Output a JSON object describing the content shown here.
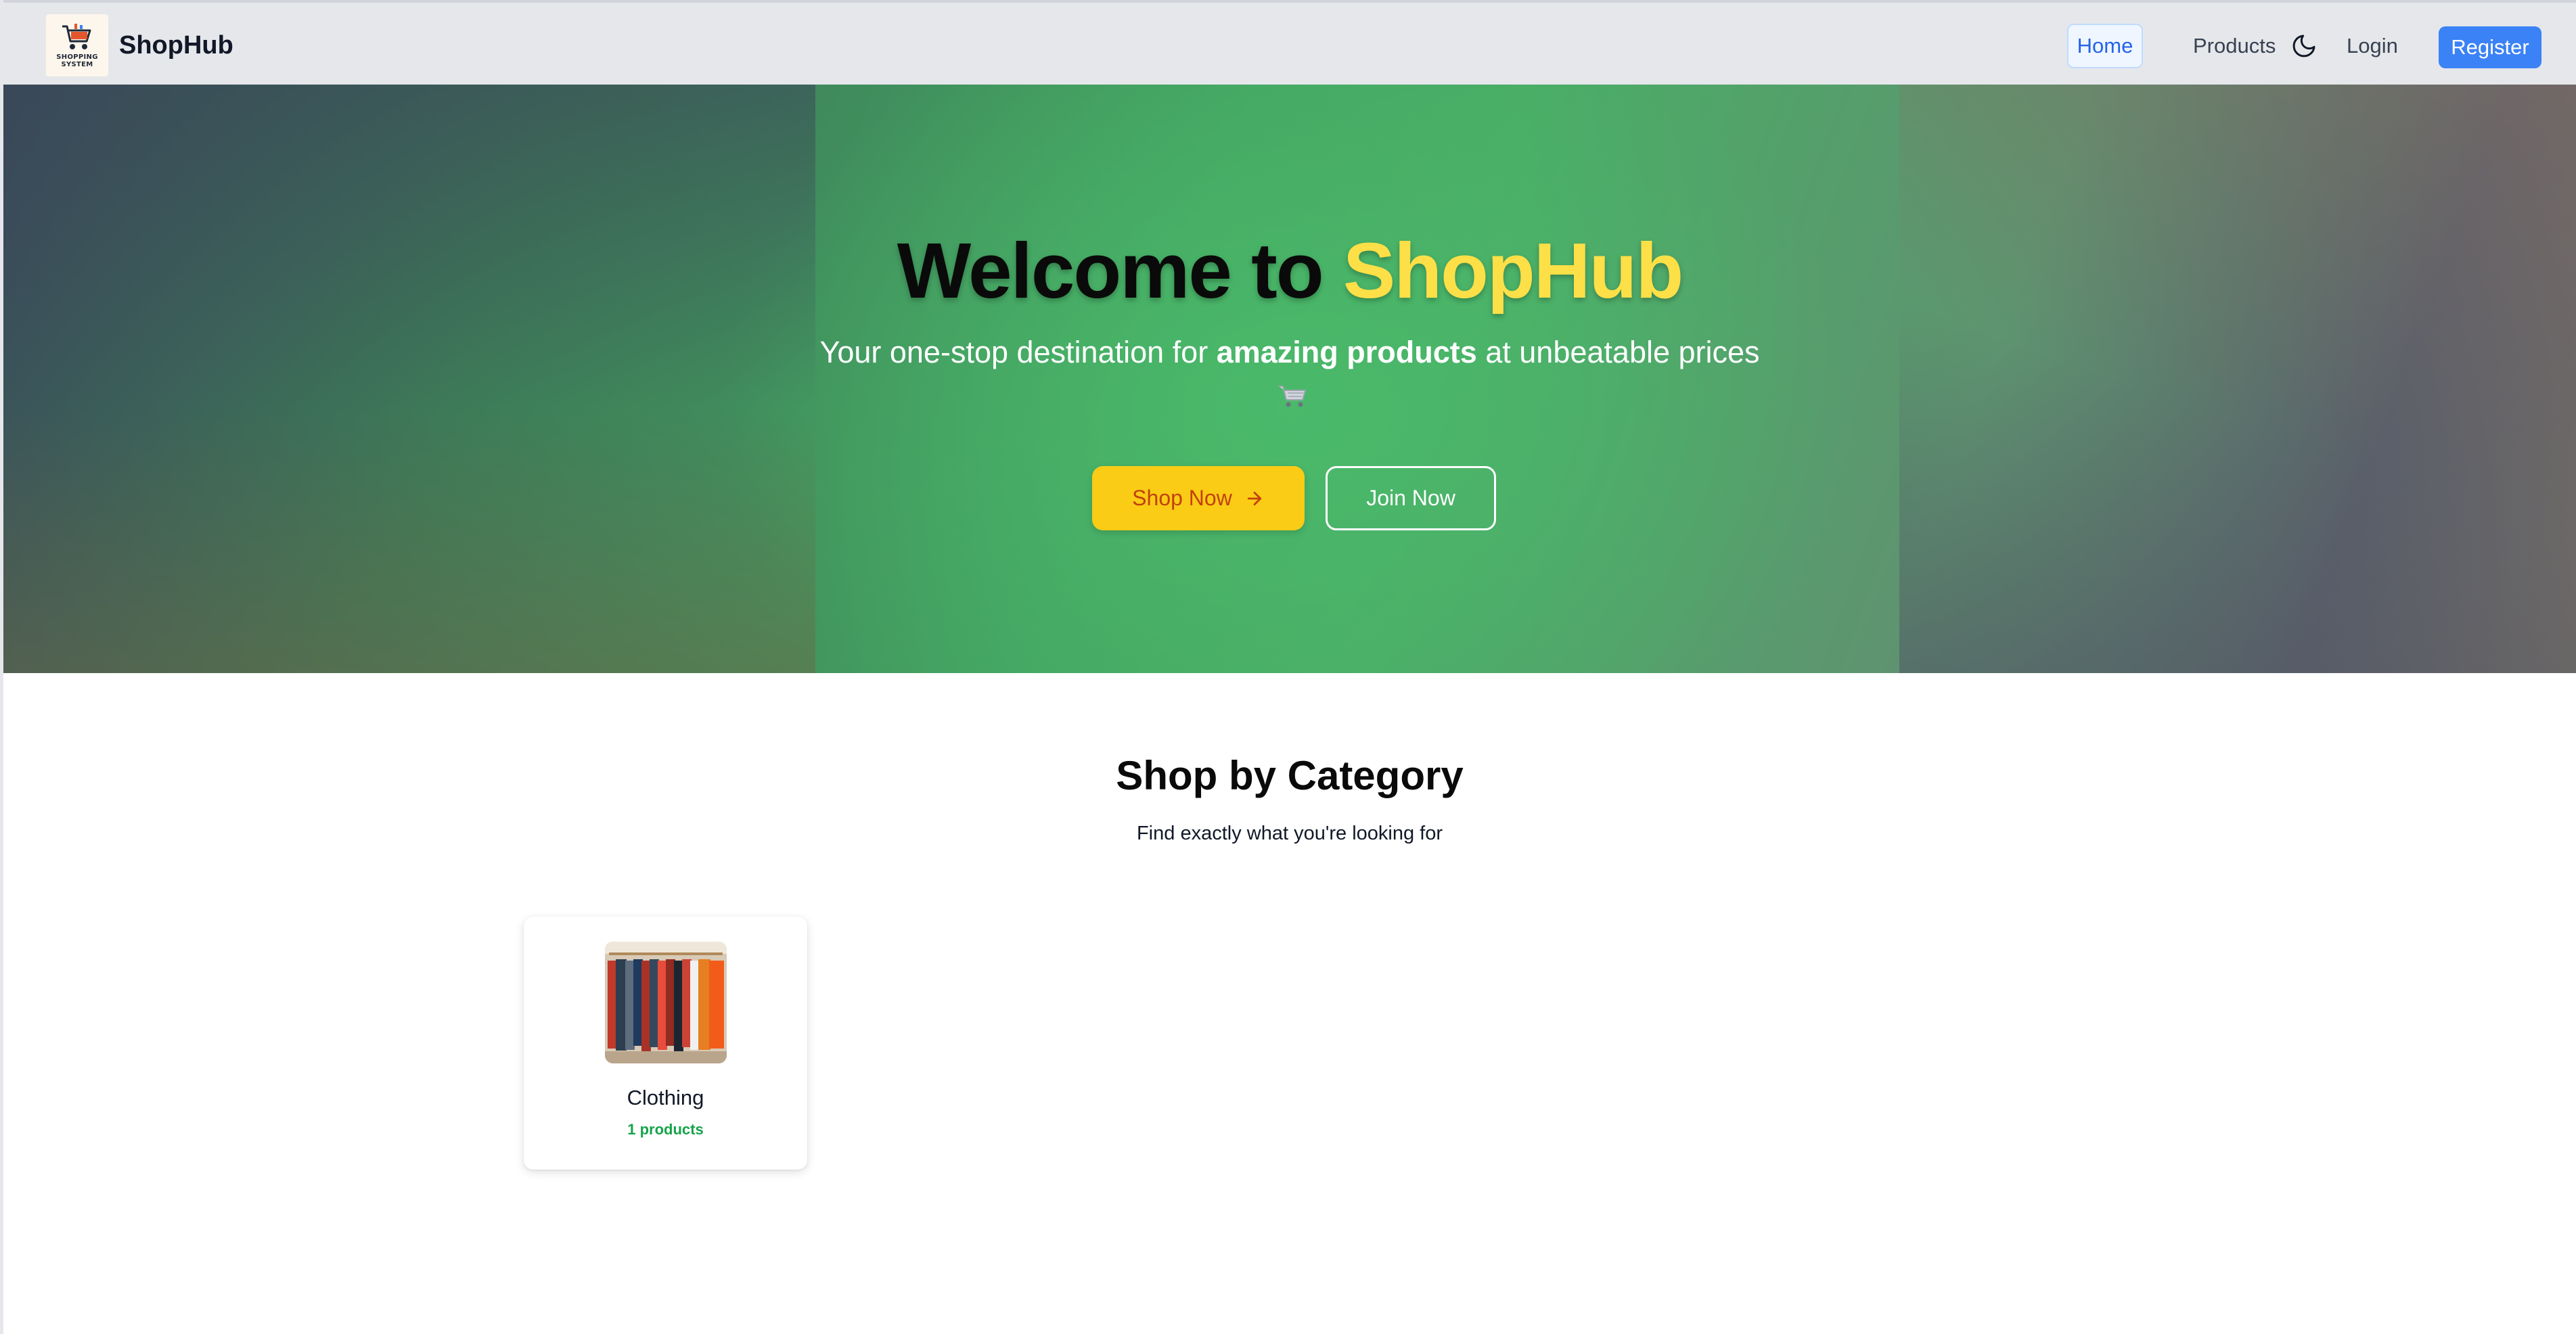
{
  "navbar": {
    "logo_text": "SHOPPING SYSTEM",
    "brand": "ShopHub",
    "links": {
      "home": "Home",
      "products": "Products",
      "login": "Login",
      "register": "Register"
    },
    "theme_toggle_icon": "moon-icon"
  },
  "hero": {
    "title_part1": "Welcome to ",
    "title_part2": "ShopHub",
    "subtitle_pre": "Your one-stop destination for ",
    "subtitle_bold": "amazing products",
    "subtitle_post": " at unbeatable prices",
    "emoji_icon": "shopping-cart-icon",
    "buttons": {
      "shop": "Shop Now",
      "join": "Join Now"
    }
  },
  "categories": {
    "title": "Shop by Category",
    "subtitle": "Find exactly what you're looking for",
    "items": [
      {
        "name": "Clothing",
        "count": "1 products"
      }
    ]
  },
  "colors": {
    "accent_blue": "#3b82f6",
    "brand_yellow": "#fde047",
    "button_yellow": "#facc15",
    "count_green": "#16a34a"
  }
}
